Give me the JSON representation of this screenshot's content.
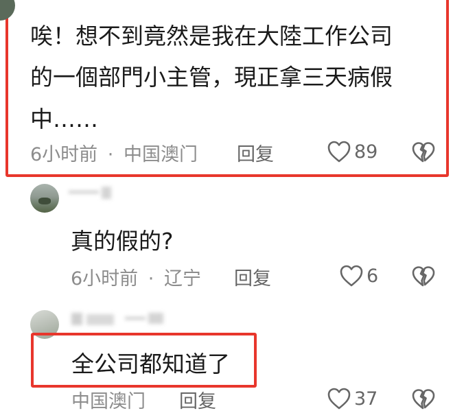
{
  "comments": [
    {
      "lines": [
        "唉！想不到竟然是我在大陸工作公司",
        "的一個部門小主管，現正拿三天病假",
        "中……"
      ],
      "time": "6小时前",
      "separator": "·",
      "location": "中国澳门",
      "reply_label": "回复",
      "likes": "89"
    },
    {
      "text": "真的假的?",
      "time": "6小时前",
      "separator": "·",
      "location": "辽宁",
      "reply_label": "回复",
      "likes": "6"
    },
    {
      "text": "全公司都知道了",
      "location": "中国澳门",
      "reply_label": "回复",
      "likes": "37"
    }
  ],
  "colors": {
    "highlight": "#e8362c",
    "meta": "#8c8c8c",
    "text": "#1a1a1a",
    "icon": "#666666"
  },
  "icons": [
    "heart-icon",
    "broken-heart-icon"
  ]
}
